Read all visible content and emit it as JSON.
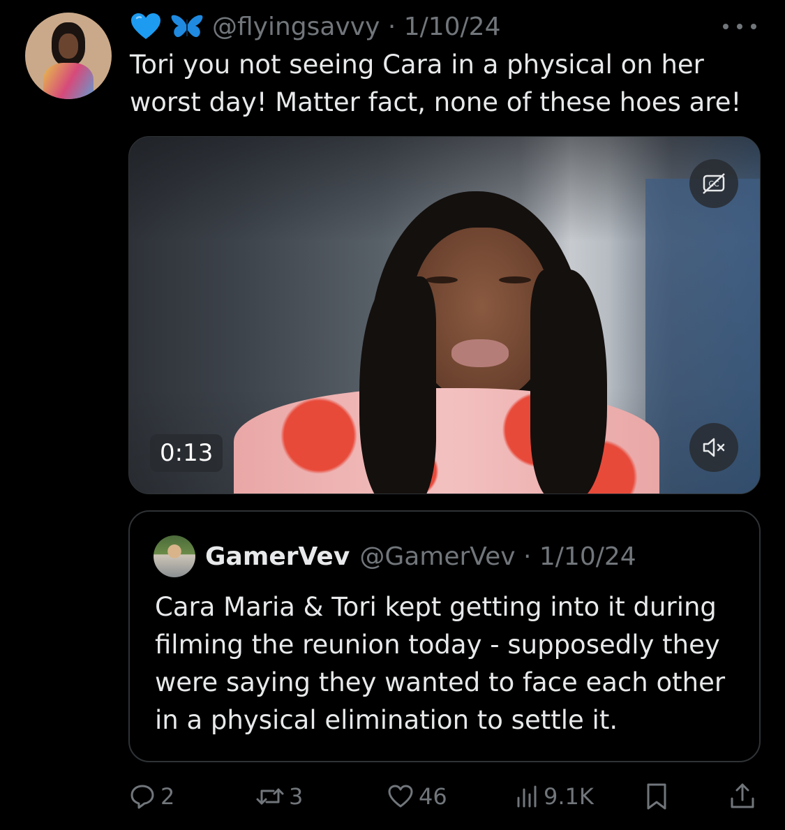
{
  "tweet": {
    "avatar_alt": "profile photo",
    "badge_emojis": [
      "heart-blue",
      "butterfly-blue"
    ],
    "handle": "@flyingsavvy",
    "date": "1/10/24",
    "handle_date": "@flyingsavvy · 1/10/24",
    "text": "Tori you not seeing Cara in a physical on her\nworst day! Matter fact, none of these hoes are!"
  },
  "video": {
    "duration": "0:13",
    "captions_icon": "captions-icon",
    "mute_icon": "volume-muted-icon"
  },
  "quote": {
    "name": "GamerVev",
    "handle_date": "@GamerVev · 1/10/24",
    "text": "Cara Maria & Tori kept getting into it during filming the reunion today - supposedly they were saying they wanted to face each other in a physical elimination to settle it."
  },
  "actions": {
    "replies": "2",
    "reposts": "3",
    "likes": "46",
    "views": "9.1K"
  },
  "colors": {
    "background": "#000000",
    "text": "#e7e9ea",
    "muted": "#71767b",
    "border": "#2f3336",
    "heart": "#1d9bf0"
  }
}
